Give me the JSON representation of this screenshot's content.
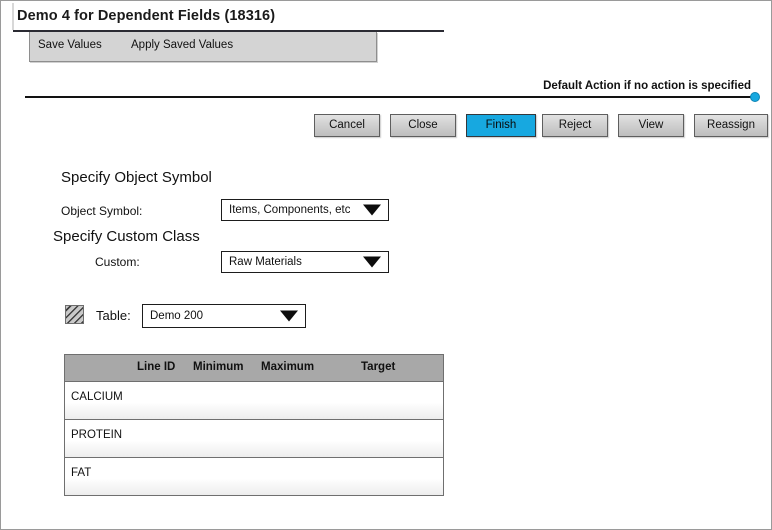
{
  "window": {
    "title": "Demo 4 for Dependent Fields (18316)"
  },
  "toolbar": {
    "save_values": "Save Values",
    "apply_saved_values": "Apply Saved Values"
  },
  "default_action": {
    "label": "Default Action if no action is specified",
    "marker_color": "#17a8e0"
  },
  "actions": {
    "buttons": [
      {
        "label": "Cancel",
        "primary": false
      },
      {
        "label": "Close",
        "primary": false
      },
      {
        "label": "Finish",
        "primary": true
      },
      {
        "label": "Reject",
        "primary": false
      },
      {
        "label": "View",
        "primary": false
      },
      {
        "label": "Reassign",
        "primary": false
      }
    ],
    "primary_color": "#17a8e0"
  },
  "form": {
    "object_section_heading": "Specify Object Symbol",
    "object_symbol_label": "Object Symbol:",
    "object_symbol_value": "Items, Components, etc",
    "custom_section_heading": "Specify Custom Class",
    "custom_label": "Custom:",
    "custom_value": "Raw Materials",
    "table_label": "Table:",
    "table_value": "Demo 200",
    "table_icon": "hatched-square-icon"
  },
  "grid": {
    "columns": [
      "Line ID",
      "Minimum",
      "Maximum",
      "Target"
    ],
    "rows": [
      {
        "name": "CALCIUM",
        "line_id": "",
        "minimum": "",
        "maximum": "",
        "target": ""
      },
      {
        "name": "PROTEIN",
        "line_id": "",
        "minimum": "",
        "maximum": "",
        "target": ""
      },
      {
        "name": "FAT",
        "line_id": "",
        "minimum": "",
        "maximum": "",
        "target": ""
      }
    ]
  }
}
